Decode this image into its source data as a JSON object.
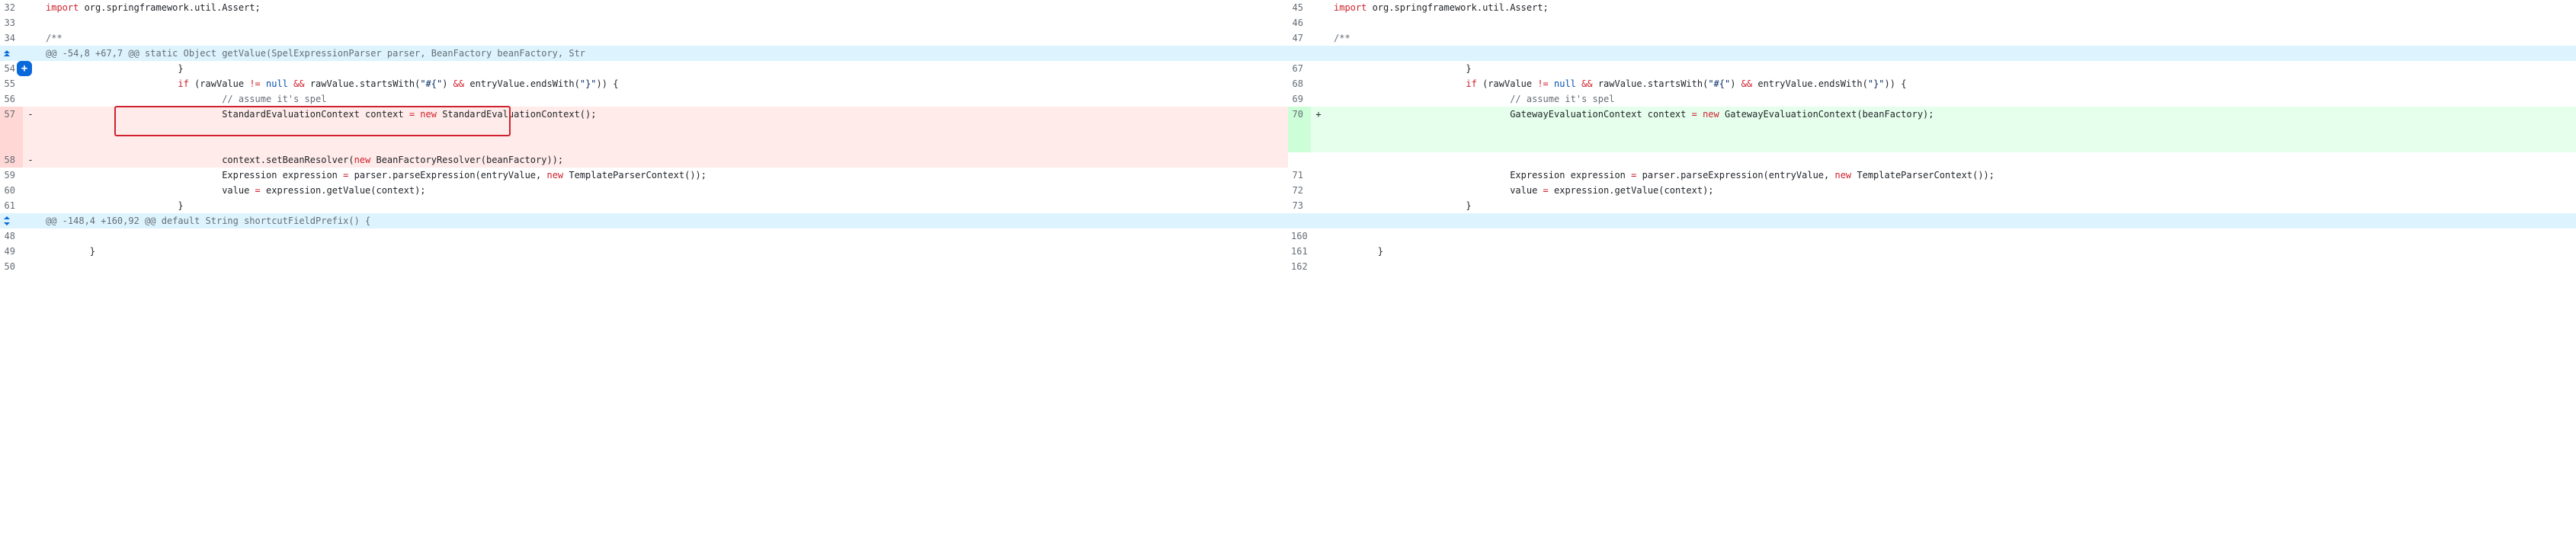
{
  "hunks": [
    {
      "header": "@@ -54,8 +67,7 @@ static Object getValue(SpelExpressionParser parser, BeanFactory beanFactory, Str",
      "header2": "@@ -148,4 +160,92 @@ default String shortcutFieldPrefix() {"
    }
  ],
  "lines": {
    "l32": "32",
    "l33": "33",
    "l34": "34",
    "r45": "45",
    "r46": "46",
    "r47": "47",
    "l54": "54",
    "l55": "55",
    "l56": "56",
    "l57": "57",
    "l58": "58",
    "l59": "59",
    "l60": "60",
    "l61": "61",
    "r67": "67",
    "r68": "68",
    "r69": "69",
    "r70": "70",
    "r71": "71",
    "r72": "72",
    "r73": "73",
    "l148": "48",
    "l149": "49",
    "l150": "50",
    "r160": "160",
    "r161": "161",
    "r162": "162"
  },
  "code": {
    "import_kw": "import",
    "import_pkg": " org.springframework.util.Assert;",
    "blank": "",
    "doccomment": "/**",
    "close_brace_3": "\t\t\t}",
    "close_brace_2": "\t\t}",
    "close_brace_1": "\t}",
    "if_pre": "\t\t\t",
    "if_kw": "if",
    "if_open": " (rawValue ",
    "neq": "!=",
    "null_kw": " null ",
    "and": "&&",
    "startswith": " rawValue.startsWith(",
    "str_hash": "\"#{\"",
    "paren_close": ") ",
    "endswith": " entryValue.endsWith(",
    "str_brace": "\"}\"",
    "if_tail": ")) {",
    "comment_spel": "\t\t\t\t// assume it's spel",
    "std_ctx_pre": "\t\t\t\tStandardEvaluationContext context ",
    "eq": "=",
    "new_kw": " new ",
    "std_ctx": "StandardEvaluationContext();",
    "setbean_pre": "\t\t\t\tcontext.setBeanResolver(",
    "new_kw2": "new ",
    "beanresolver": "BeanFactoryResolver(beanFactory));",
    "gw_ctx_pre": "\t\t\t\tGatewayEvaluationContext context ",
    "gw_ctx": "GatewayEvaluationContext(beanFactory);",
    "expr_pre": "\t\t\t\tExpression expression ",
    "parseexpr": " parser.parseExpression(entryValue, ",
    "tpc": "TemplateParserContext());",
    "value_pre": "\t\t\t\tvalue ",
    "getvalue": " expression.getValue(context);"
  },
  "markers": {
    "minus": "-",
    "plus": "+"
  }
}
